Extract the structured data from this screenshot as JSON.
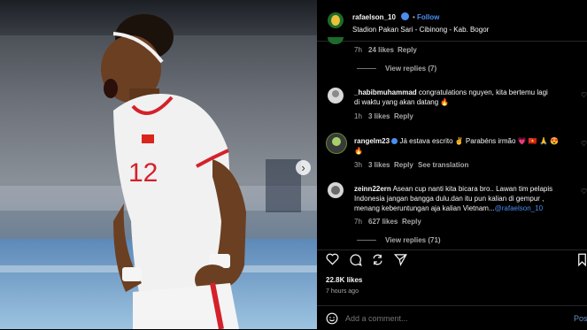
{
  "post": {
    "author": "rafaelson_10",
    "follow_label": "Follow",
    "separator": "•",
    "location": "Stadion Pakan Sari - Cibinong - Kab. Bogor"
  },
  "comments": [
    {
      "meta_time": "7h",
      "meta_likes": "24 likes",
      "meta_reply": "Reply",
      "view_replies": "View replies (7)"
    },
    {
      "username": "_habibmuhammad",
      "text_line1": "congratulations nguyen, kita bertemu lagi",
      "text_line2": "di waktu yang akan datang 🔥",
      "meta_time": "1h",
      "meta_likes": "3 likes",
      "meta_reply": "Reply"
    },
    {
      "username": "rangelm23",
      "text_line1": "Já estava escrito ✌️ Parabéns irmão 💗 🇻🇳 🙏 😍",
      "text_line2": "🔥",
      "meta_time": "3h",
      "meta_likes": "3 likes",
      "meta_reply": "Reply",
      "meta_translate": "See translation"
    },
    {
      "username": "zeinn22ern",
      "text_line1": "Asean cup nanti kita bicara bro.. Lawan tim pelapis",
      "text_line2": "Indonesia jangan bangga dulu.dan itu pun kalian di gempur ,",
      "text_line3": "menang keberuntungan aja kalian Vietnam...",
      "mention": "@rafaelson_10",
      "meta_time": "7h",
      "meta_likes": "627 likes",
      "meta_reply": "Reply",
      "view_replies": "View replies (71)"
    }
  ],
  "stats": {
    "likes": "22.8K likes",
    "time_ago": "7 hours ago"
  },
  "composer": {
    "placeholder": "Add a comment...",
    "post_label": "Pos"
  },
  "photo": {
    "jersey_number": "12"
  },
  "colors": {
    "accent": "#4a8ef0",
    "background": "#000000"
  }
}
